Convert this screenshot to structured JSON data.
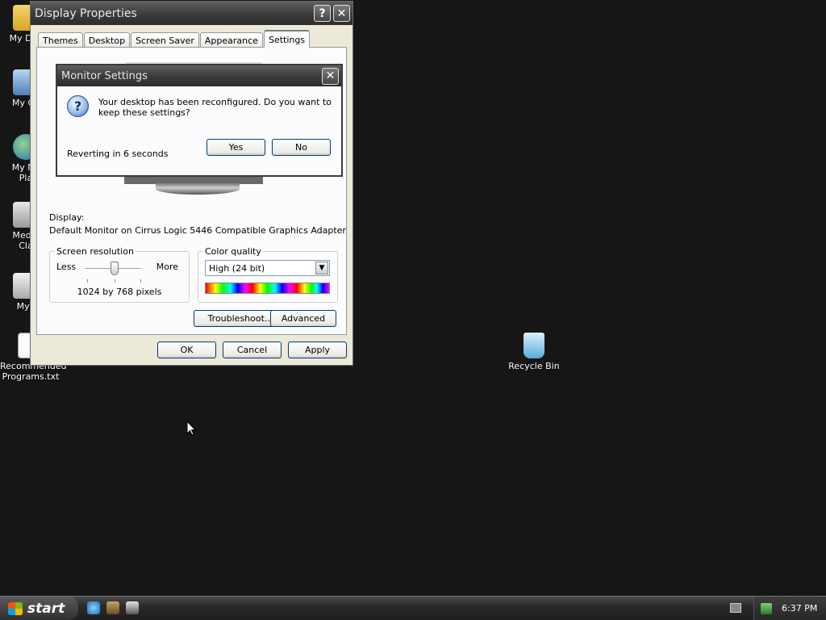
{
  "desktop": {
    "icons": [
      {
        "label": "My Doc",
        "icon": "folder-icon"
      },
      {
        "label": "My Co",
        "icon": "computer-icon"
      },
      {
        "label": "My Ne",
        "label2": "Pla",
        "icon": "network-icon"
      },
      {
        "label": "Media",
        "label2": "Cla",
        "icon": "media-icon"
      },
      {
        "label": "MyP",
        "icon": "shortcut-icon"
      },
      {
        "label": "Recommended",
        "label2": "Programs.txt",
        "icon": "text-file-icon"
      }
    ],
    "recycle_bin": {
      "label": "Recycle Bin",
      "icon": "recycle-bin-icon"
    }
  },
  "display_properties": {
    "title": "Display Properties",
    "help_button": "?",
    "close_button": "✕",
    "tabs": [
      "Themes",
      "Desktop",
      "Screen Saver",
      "Appearance",
      "Settings"
    ],
    "active_tab": "Settings",
    "display_label": "Display:",
    "display_adapter": "Default Monitor on Cirrus Logic 5446 Compatible Graphics Adapter",
    "screen_resolution": {
      "legend": "Screen resolution",
      "less": "Less",
      "more": "More",
      "value": "1024 by 768 pixels"
    },
    "color_quality": {
      "legend": "Color quality",
      "selected": "High (24 bit)",
      "arrow": "▼"
    },
    "troubleshoot_label": "Troubleshoot...",
    "advanced_label": "Advanced",
    "ok_label": "OK",
    "cancel_label": "Cancel",
    "apply_label": "Apply"
  },
  "monitor_settings": {
    "title": "Monitor Settings",
    "close_button": "✕",
    "question_glyph": "?",
    "message": "Your desktop has been reconfigured.  Do you want to keep these settings?",
    "countdown": "Reverting in 6 seconds",
    "yes_label": "Yes",
    "no_label": "No"
  },
  "taskbar": {
    "start_label": "start",
    "clock": "6:37 PM"
  }
}
